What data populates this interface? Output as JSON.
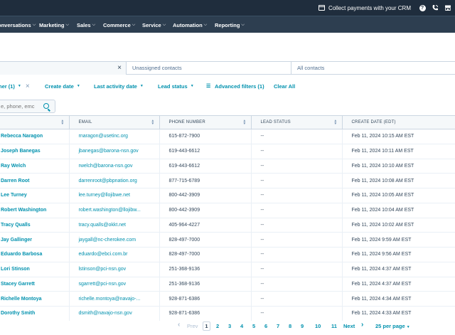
{
  "topbar": {
    "collect_label": "Collect payments with your CRM",
    "help_label": "?"
  },
  "nav": {
    "items": [
      {
        "label": "onversations"
      },
      {
        "label": "Marketing"
      },
      {
        "label": "Sales"
      },
      {
        "label": "Commerce"
      },
      {
        "label": "Service"
      },
      {
        "label": "Automation"
      },
      {
        "label": "Reporting"
      }
    ]
  },
  "tabs": {
    "active_close": "×",
    "unassigned": "Unassigned contacts",
    "all": "All contacts"
  },
  "filters": {
    "owner": "ner (1)",
    "create_date": "Create date",
    "last_activity": "Last activity date",
    "lead_status": "Lead status",
    "advanced": "Advanced filters (1)",
    "clear_all": "Clear All"
  },
  "search": {
    "placeholder": "e, phone, emc"
  },
  "table": {
    "headers": [
      "",
      "EMAIL",
      "PHONE NUMBER",
      "LEAD STATUS",
      "CREATE DATE (EDT)"
    ],
    "rows": [
      {
        "name": "Rebecca Naragon",
        "email": "rnaragon@usetinc.org",
        "phone": "615-872-7900",
        "lead": "--",
        "date": "Feb 11, 2024 10:15 AM EST"
      },
      {
        "name": "Joseph Banegas",
        "email": "jbanegas@barona-nsn.gov",
        "phone": "619-443-6612",
        "lead": "--",
        "date": "Feb 11, 2024 10:11 AM EST"
      },
      {
        "name": "Ray Welch",
        "email": "rwelch@barona-nsn.gov",
        "phone": "619-443-6612",
        "lead": "--",
        "date": "Feb 11, 2024 10:10 AM EST"
      },
      {
        "name": "Darren Root",
        "email": "darrenroot@pbpnation.org",
        "phone": "877-715-6789",
        "lead": "--",
        "date": "Feb 11, 2024 10:08 AM EST"
      },
      {
        "name": "Lee Turney",
        "email": "lee.turney@llojibwe.net",
        "phone": "800-442-3909",
        "lead": "--",
        "date": "Feb 11, 2024 10:05 AM EST"
      },
      {
        "name": "Robert Washington",
        "email": "robert.washington@llojibw...",
        "phone": "800-442-3909",
        "lead": "--",
        "date": "Feb 11, 2024 10:04 AM EST"
      },
      {
        "name": "Tracy Qualls",
        "email": "tracy.qualls@okkt.net",
        "phone": "405-964-4227",
        "lead": "--",
        "date": "Feb 11, 2024 10:02 AM EST"
      },
      {
        "name": "Jay Gallinger",
        "email": "jaygall@nc-cherokee.com",
        "phone": "828-497-7000",
        "lead": "--",
        "date": "Feb 11, 2024 9:59 AM EST"
      },
      {
        "name": "Eduardo Barbosa",
        "email": "eduardo@ebci.com.br",
        "phone": "828-497-7000",
        "lead": "--",
        "date": "Feb 11, 2024 9:56 AM EST"
      },
      {
        "name": "Lori Stinson",
        "email": "lstinson@pci-nsn.gov",
        "phone": "251-368-9136",
        "lead": "--",
        "date": "Feb 11, 2024 4:37 AM EST"
      },
      {
        "name": "Stacey Garrett",
        "email": "sgarrett@pci-nsn.gov",
        "phone": "251-368-9136",
        "lead": "--",
        "date": "Feb 11, 2024 4:37 AM EST"
      },
      {
        "name": "Richelle Montoya",
        "email": "richelle.montoya@navajo-...",
        "phone": "928-871-6386",
        "lead": "--",
        "date": "Feb 11, 2024 4:34 AM EST"
      },
      {
        "name": "Dorothy Smith",
        "email": "dsmith@navajo-nsn.gov",
        "phone": "928-871-6386",
        "lead": "--",
        "date": "Feb 11, 2024 4:33 AM EST"
      }
    ]
  },
  "pager": {
    "prev": "Prev",
    "pages": [
      "1",
      "2",
      "3",
      "4",
      "5",
      "6",
      "7",
      "8",
      "9",
      "10",
      "11"
    ],
    "next": "Next",
    "per_page": "25 per page"
  }
}
